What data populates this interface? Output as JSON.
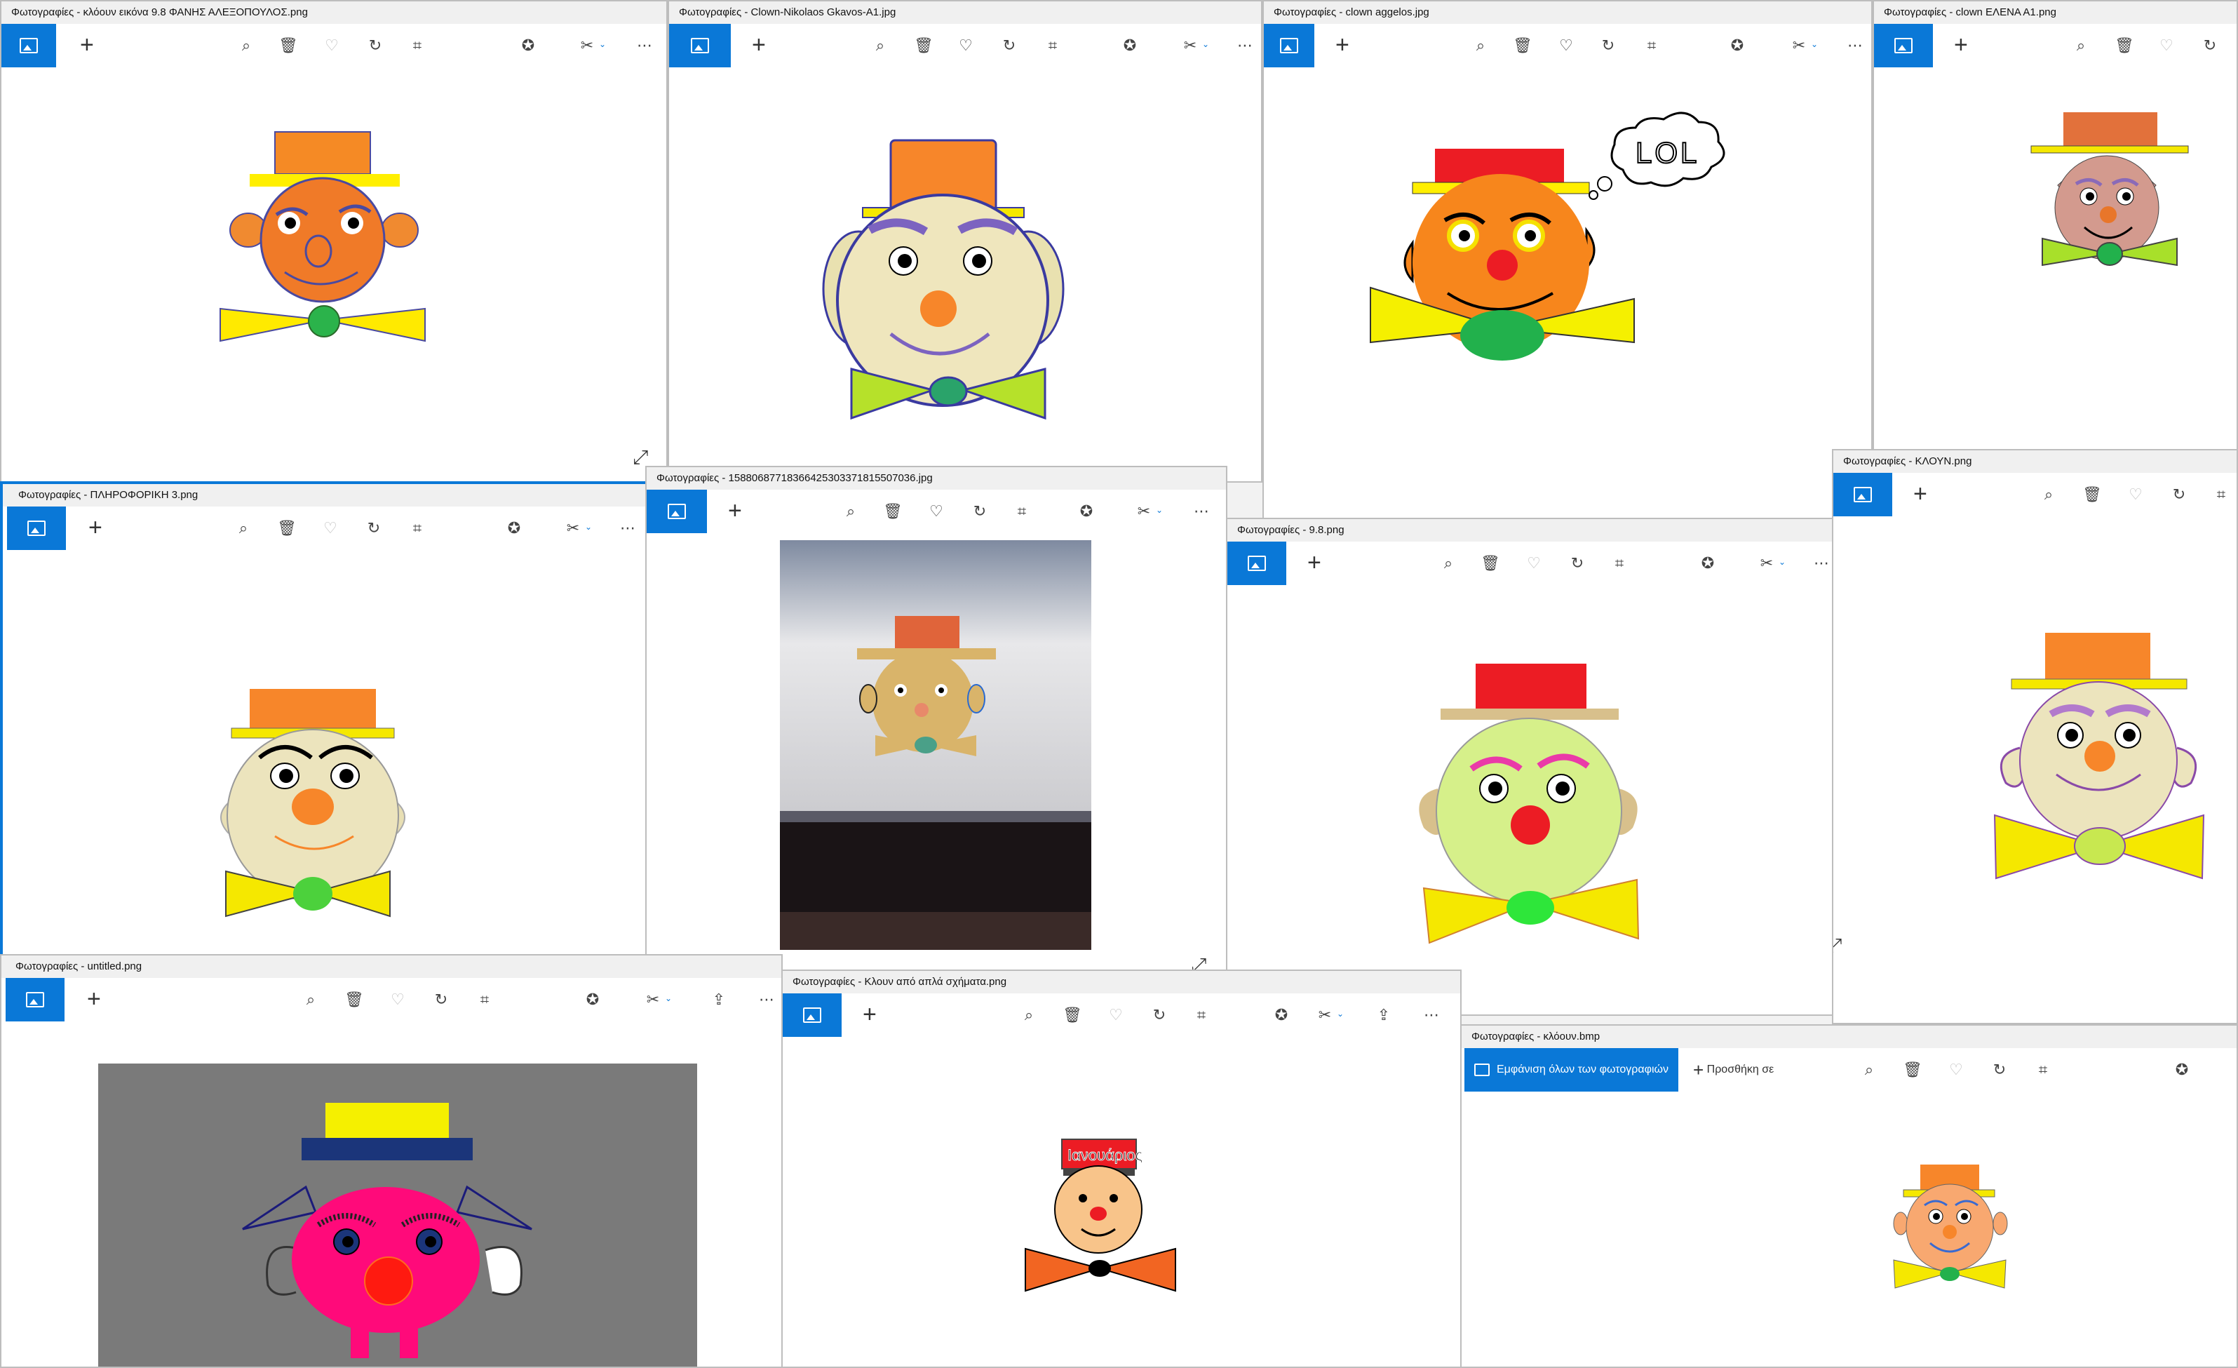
{
  "app": "Φωτογραφίες",
  "windows": [
    {
      "title": "Φωτογραφίες - κλόουν εικόνα 9.8 ΦΑΝΗΣ ΑΛΕΞΟΠΟΥΛΟΣ.png"
    },
    {
      "title": "Φωτογραφίες - Clown-Nikolaos Gkavos-A1.jpg"
    },
    {
      "title": "Φωτογραφίες - clown aggelos.jpg"
    },
    {
      "title": "Φωτογραφίες - clown ΕΛΕΝΑ Α1.png"
    },
    {
      "title": "Φωτογραφίες - ΠΛΗΡΟΦΟΡΙΚΗ 3.png"
    },
    {
      "title": "Φωτογραφίες - 15880687718366425303371815507036.jpg"
    },
    {
      "title": "Φωτογραφίες - 9.8.png"
    },
    {
      "title": "Φωτογραφίες - ΚΛΟΥΝ.png"
    },
    {
      "title": "Φωτογραφίες - untitled.png"
    },
    {
      "title": "Φωτογραφίες - Κλουν από απλά σχήματα.png"
    },
    {
      "title": "Φωτογραφίες - κλόουν.bmp"
    }
  ],
  "speech_bubble": "LOL",
  "hat_text": "Ιανουάριος",
  "last_window": {
    "view_all_label": "Εμφάνιση όλων των φωτογραφιών",
    "add_to_label": "Προσθήκη σε"
  },
  "icons": {
    "zoom": "zoom-icon",
    "delete": "trash-icon",
    "favorite": "heart-icon",
    "rotate": "rotate-icon",
    "crop": "crop-icon",
    "enhance": "enhance-icon",
    "edit": "edit-create-icon",
    "more": "more-icon",
    "share": "share-icon"
  },
  "colors": {
    "accent": "#0a78d7"
  }
}
